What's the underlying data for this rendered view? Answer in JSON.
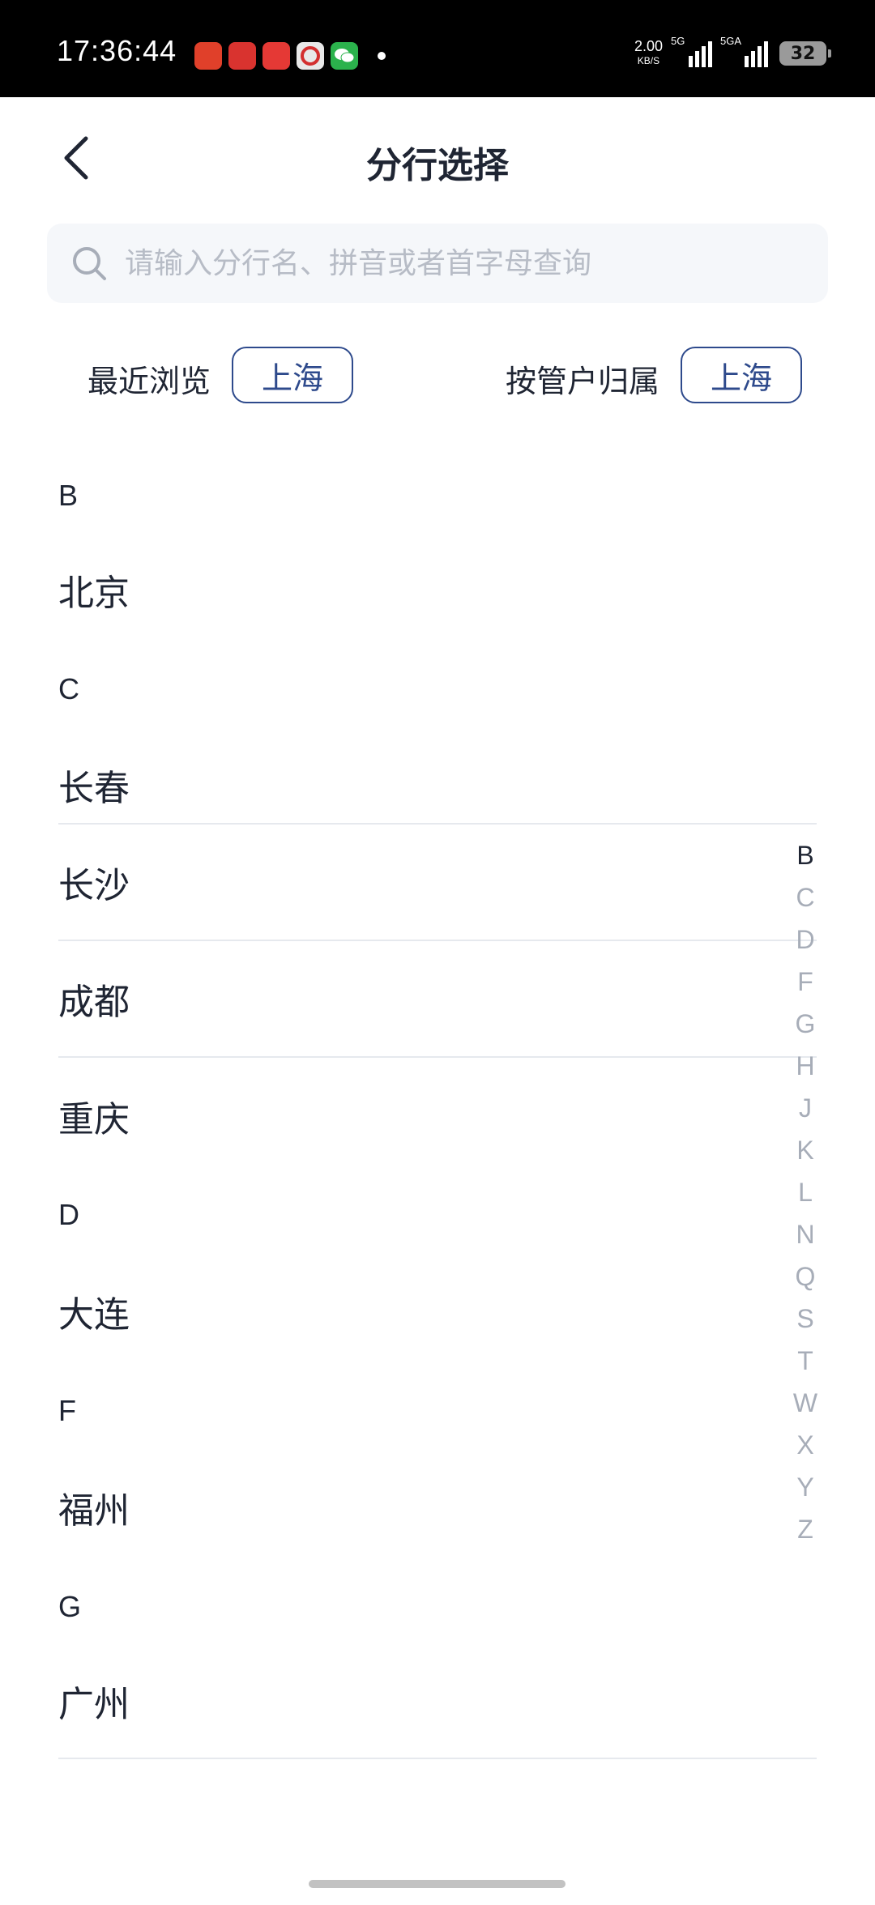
{
  "status_bar": {
    "time": "17:36:44",
    "net_speed_value": "2.00",
    "net_speed_unit": "KB/S",
    "signal1_tag": "5G",
    "signal2_tag": "5GA",
    "battery": "32"
  },
  "header": {
    "title": "分行选择"
  },
  "search": {
    "placeholder": "请输入分行名、拼音或者首字母查询"
  },
  "quick": {
    "recent_label": "最近浏览",
    "recent_value": "上海",
    "account_label": "按管户归属",
    "account_value": "上海"
  },
  "sections": [
    {
      "letter": "B",
      "cities": [
        "北京"
      ]
    },
    {
      "letter": "C",
      "cities": [
        "长春",
        "长沙",
        "成都",
        "重庆"
      ]
    },
    {
      "letter": "D",
      "cities": [
        "大连"
      ]
    },
    {
      "letter": "F",
      "cities": [
        "福州"
      ]
    },
    {
      "letter": "G",
      "cities": [
        "广州"
      ]
    }
  ],
  "alphabet": [
    "B",
    "C",
    "D",
    "F",
    "G",
    "H",
    "J",
    "K",
    "L",
    "N",
    "Q",
    "S",
    "T",
    "W",
    "X",
    "Y",
    "Z"
  ],
  "alphabet_active": "B",
  "colors": {
    "accent": "#2e4a8c",
    "text": "#1f2533",
    "muted": "#a7adb8"
  }
}
